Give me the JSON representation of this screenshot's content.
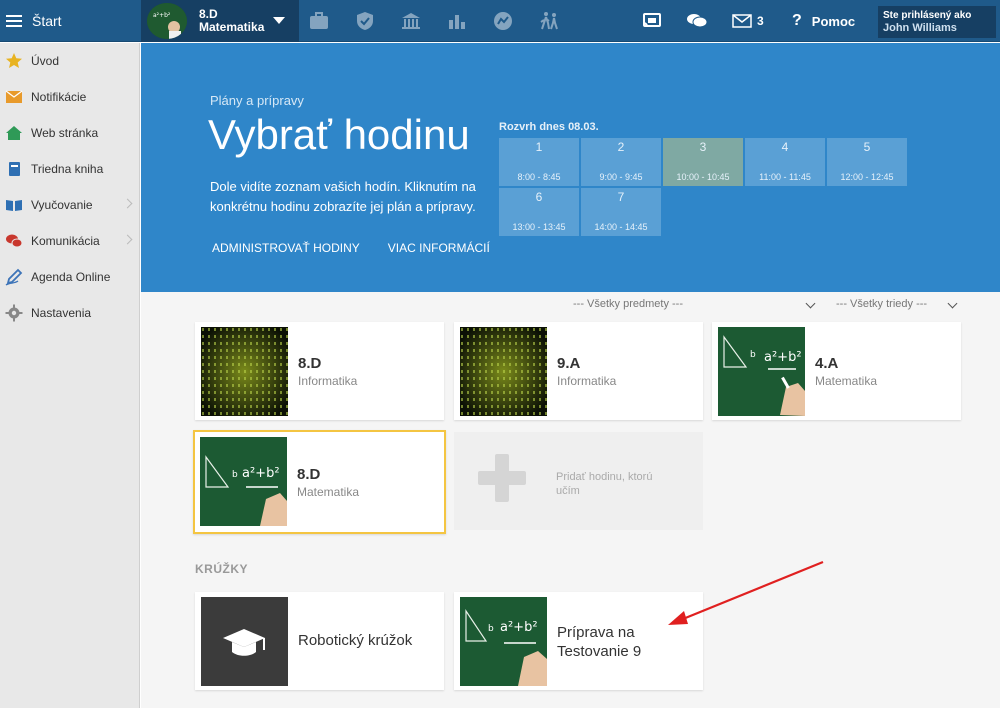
{
  "topbar": {
    "start_label": "Štart",
    "class_name": "8.D",
    "class_subject": "Matematika",
    "message_count": "3",
    "help_label": "Pomoc",
    "login_label": "Ste prihlásený ako",
    "user_name": "John Williams",
    "icons": [
      "briefcase-icon",
      "shield-icon",
      "bank-icon",
      "bar-chart-icon",
      "stats-circle-icon",
      "walking-icon",
      "cast-icon",
      "chat-icon",
      "mail-icon",
      "question-icon"
    ]
  },
  "sidebar": {
    "items": [
      {
        "label": "Úvod",
        "icon": "star-icon",
        "color": "#e8b321"
      },
      {
        "label": "Notifikácie",
        "icon": "envelope-icon",
        "color": "#e89a2b"
      },
      {
        "label": "Web stránka",
        "icon": "home-icon",
        "color": "#2f9a57"
      },
      {
        "label": "Triedna kniha",
        "icon": "book-icon",
        "color": "#2e6fb3"
      },
      {
        "label": "Vyučovanie",
        "icon": "open-book-icon",
        "color": "#2e6fb3"
      },
      {
        "label": "Komunikácia",
        "icon": "chat-bubbles-icon",
        "color": "#c8372d"
      },
      {
        "label": "Agenda Online",
        "icon": "pen-icon",
        "color": "#3d74b8"
      },
      {
        "label": "Nastavenia",
        "icon": "gear-icon",
        "color": "#888888"
      }
    ]
  },
  "hero": {
    "subtitle": "Plány a prípravy",
    "title": "Vybrať hodinu",
    "description": "Dole vidíte zoznam vašich hodín. Kliknutím na konkrétnu hodinu zobrazíte jej plán a prípravy.",
    "link_admin": "ADMINISTROVAŤ HODINY",
    "link_more": "VIAC INFORMÁCIÍ",
    "schedule_label": "Rozvrh dnes 08.03.",
    "slots": [
      {
        "n": "1",
        "time": "8:00 - 8:45"
      },
      {
        "n": "2",
        "time": "9:00 - 9:45"
      },
      {
        "n": "3",
        "time": "10:00 - 10:45",
        "active": true
      },
      {
        "n": "4",
        "time": "11:00 - 11:45"
      },
      {
        "n": "5",
        "time": "12:00 - 12:45"
      },
      {
        "n": "6",
        "time": "13:00 - 13:45"
      },
      {
        "n": "7",
        "time": "14:00 - 14:45"
      }
    ]
  },
  "filters": {
    "subjects": "--- Všetky predmety ---",
    "classes": "--- Všetky triedy ---"
  },
  "cards": [
    {
      "name": "8.D",
      "subject": "Informatika",
      "thumb": "matrix"
    },
    {
      "name": "9.A",
      "subject": "Informatika",
      "thumb": "matrix"
    },
    {
      "name": "4.A",
      "subject": "Matematika",
      "thumb": "chalk"
    },
    {
      "name": "8.D",
      "subject": "Matematika",
      "thumb": "chalk",
      "selected": true
    }
  ],
  "add_card": {
    "label": "Pridať hodinu, ktorú učím"
  },
  "section_label": "KRÚŽKY",
  "clubs": [
    {
      "name": "Robotický krúžok",
      "thumb": "cap"
    },
    {
      "name": "Príprava na Testovanie 9",
      "thumb": "chalk"
    }
  ],
  "colors": {
    "topbar": "#1f5a8a",
    "hero": "#2f86c9",
    "selected_border": "#f4c542",
    "arrow": "#e02020"
  }
}
